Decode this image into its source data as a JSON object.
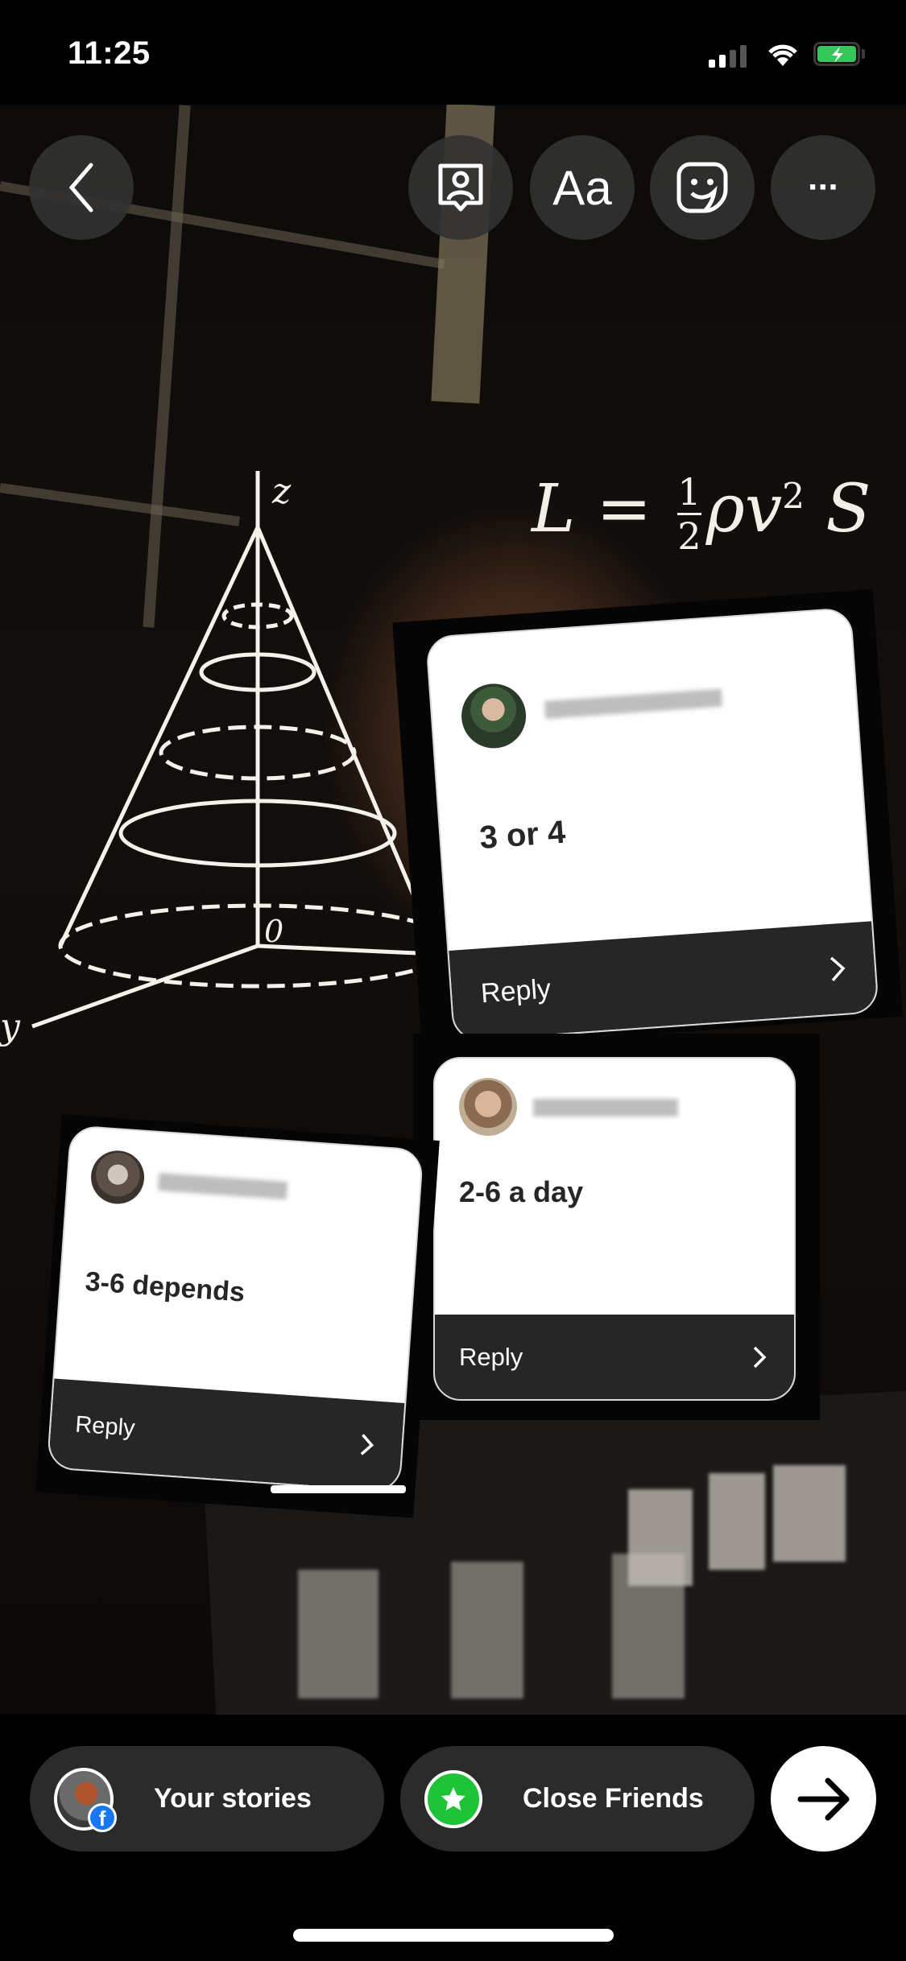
{
  "status_bar": {
    "time": "11:25",
    "battery_color": "#35c759",
    "charging": true
  },
  "toolbar": {
    "back_icon": "chevron-left-icon",
    "buttons": [
      {
        "name": "mention-icon"
      },
      {
        "name": "text-tool",
        "label": "Aa"
      },
      {
        "name": "sticker-icon"
      },
      {
        "name": "more-icon",
        "label": "···"
      }
    ]
  },
  "canvas": {
    "equation": {
      "lhs": "L",
      "eq": "=",
      "num": "1",
      "den": "2",
      "rhs": "ρv",
      "sup": "2",
      "tail": "S"
    },
    "cone_labels": {
      "z": "z",
      "origin": "0",
      "y": "y"
    }
  },
  "question_replies": [
    {
      "answer": "3 or 4",
      "reply_label": "Reply"
    },
    {
      "answer": "2-6 a day",
      "reply_label": "Reply"
    },
    {
      "answer": "3-6 depends",
      "reply_label": "Reply"
    }
  ],
  "share_bar": {
    "your_stories": {
      "label": "Your stories",
      "badge": "facebook-icon"
    },
    "close_friends": {
      "label": "Close Friends",
      "color": "#1ec337"
    },
    "next_icon": "arrow-right-icon"
  }
}
